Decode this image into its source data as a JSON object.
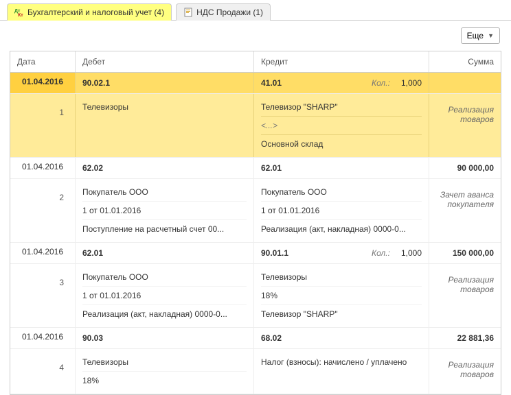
{
  "tabs": [
    {
      "label": "Бухгалтерский и налоговый учет (4)"
    },
    {
      "label": "НДС Продажи (1)"
    }
  ],
  "toolbar": {
    "more": "Еще"
  },
  "headers": {
    "date": "Дата",
    "debit": "Дебет",
    "credit": "Кредит",
    "sum": "Сумма",
    "kol": "Кол.:"
  },
  "rows": [
    {
      "date": "01.04.2016",
      "idx": "1",
      "highlight": true,
      "debit_acc": "90.02.1",
      "debit_lines": [
        "Телевизоры"
      ],
      "credit_acc": "41.01",
      "credit_qty": "1,000",
      "credit_lines": [
        "Телевизор \"SHARP\"",
        "<...>",
        "Основной склад"
      ],
      "sum": "",
      "comment": "Реализация товаров"
    },
    {
      "date": "01.04.2016",
      "idx": "2",
      "debit_acc": "62.02",
      "debit_lines": [
        "Покупатель ООО",
        "1 от 01.01.2016",
        "Поступление на расчетный счет 00..."
      ],
      "credit_acc": "62.01",
      "credit_lines": [
        "Покупатель ООО",
        "1 от 01.01.2016",
        "Реализация (акт, накладная) 0000-0..."
      ],
      "sum": "90 000,00",
      "comment": "Зачет аванса покупателя"
    },
    {
      "date": "01.04.2016",
      "idx": "3",
      "debit_acc": "62.01",
      "debit_lines": [
        "Покупатель ООО",
        "1 от 01.01.2016",
        "Реализация (акт, накладная) 0000-0..."
      ],
      "credit_acc": "90.01.1",
      "credit_qty": "1,000",
      "credit_lines": [
        "Телевизоры",
        "18%",
        "Телевизор \"SHARP\""
      ],
      "sum": "150 000,00",
      "comment": "Реализация товаров"
    },
    {
      "date": "01.04.2016",
      "idx": "4",
      "debit_acc": "90.03",
      "debit_lines": [
        "Телевизоры",
        "18%"
      ],
      "credit_acc": "68.02",
      "credit_lines": [
        "Налог (взносы): начислено / уплачено"
      ],
      "sum": "22 881,36",
      "comment": "Реализация товаров"
    }
  ]
}
